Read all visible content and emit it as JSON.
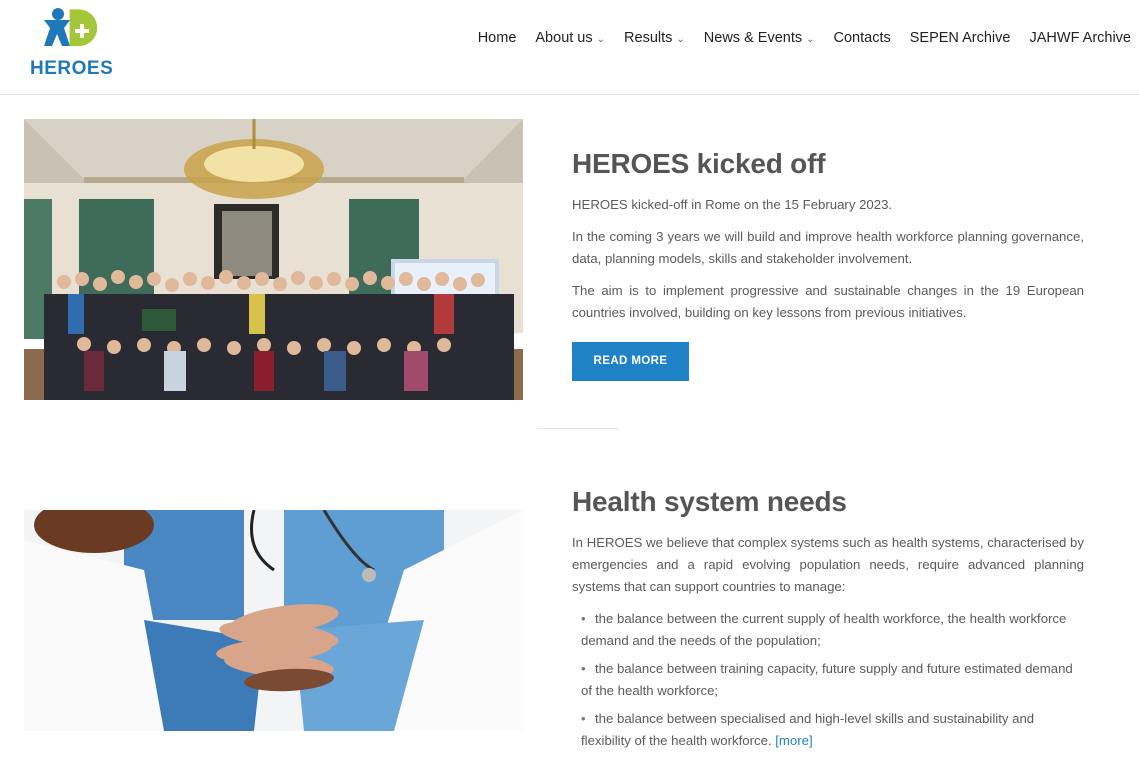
{
  "brand": {
    "logo_text": "HEROES",
    "colors": {
      "logo_blue": "#1f78b9",
      "logo_green": "#a4c639",
      "accent": "#1f82c7",
      "text": "#555555"
    }
  },
  "nav": {
    "items": [
      {
        "label": "Home",
        "dropdown": false
      },
      {
        "label": "About us",
        "dropdown": true
      },
      {
        "label": "Results",
        "dropdown": true
      },
      {
        "label": "News & Events",
        "dropdown": true
      },
      {
        "label": "Contacts",
        "dropdown": false
      },
      {
        "label": "SEPEN Archive",
        "dropdown": false
      },
      {
        "label": "JAHWF Archive",
        "dropdown": false
      }
    ],
    "chevron": "⌄"
  },
  "kickoff": {
    "title": "HEROES kicked off",
    "paragraphs": [
      "HEROES kicked-off in Rome on the 15 February 2023.",
      "In the coming 3 years we will build and improve health workforce planning governance, data, planning models, skills and stakeholder involvement.",
      "The aim is to implement progressive and sustainable changes in the 19 European countries involved, building on key lessons from previous initiatives."
    ],
    "button_label": "READ MORE",
    "image": "group-photo"
  },
  "needs": {
    "title": "Health system needs",
    "intro": "In HEROES we believe that complex systems such as health systems, characterised by emergencies and a rapid evolving population needs, require advanced planning systems that can support countries to manage:",
    "bullets": [
      "the balance between the current supply of health workforce, the health workforce demand and the needs of the population;",
      "the balance between training capacity, future supply and future estimated demand of the health workforce;",
      "the balance between specialised and high-level skills and sustainability and flexibility of the health workforce."
    ],
    "bullet_symbol": "•",
    "more_link": "[more]",
    "image": "stacked-hands-photo"
  }
}
